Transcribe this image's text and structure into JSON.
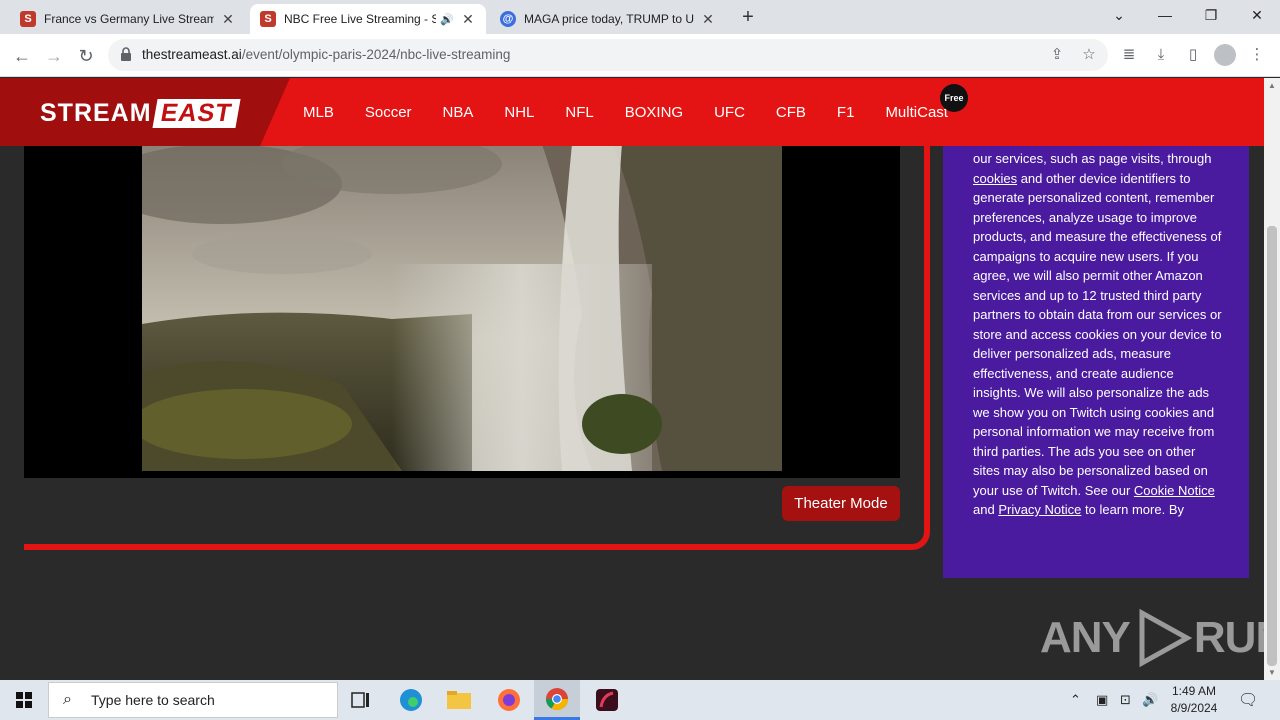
{
  "browser": {
    "tabs": [
      {
        "title": "France vs Germany Live Streamin",
        "favicon": "S",
        "favicon_color": "#c0392b",
        "active": false
      },
      {
        "title": "NBC Free Live Streaming - S",
        "favicon": "S",
        "favicon_color": "#c0392b",
        "active": true,
        "audio": "🔊"
      },
      {
        "title": "MAGA price today, TRUMP to US",
        "favicon": "@",
        "favicon_color": "#3b6fe0",
        "active": false
      }
    ],
    "url_host": "thestreameast.ai",
    "url_path": "/event/olympic-paris-2024/nbc-live-streaming"
  },
  "site": {
    "logo_left": "STREAM",
    "logo_right": "EAST",
    "nav": [
      "MLB",
      "Soccer",
      "NBA",
      "NHL",
      "NFL",
      "BOXING",
      "UFC",
      "CFB",
      "F1",
      "MultiCast"
    ],
    "free_badge": "Free",
    "brand_color": "#e51414"
  },
  "player": {
    "theater_label": "Theater Mode"
  },
  "consent": {
    "text_1": "our services, such as page visits, through ",
    "link_cookies": "cookies",
    "text_2": " and other device identifiers to generate personalized content, remember preferences, analyze usage to improve products, and measure the effectiveness of campaigns to acquire new users. If you agree, we will also permit other Amazon services and up to 12 trusted third party partners to obtain data from our services or store and access cookies on your device to deliver personalized ads, measure effectiveness, and create audience insights. We will also personalize the ads we show you on Twitch using cookies and personal information we may receive from third parties. The ads you see on other sites may also be personalized based on your use of Twitch. See our ",
    "link_cookie_notice": "Cookie Notice",
    "text_3": " and ",
    "link_privacy": "Privacy Notice",
    "text_4": " to learn more. By",
    "bg_color": "#4a1b9e"
  },
  "watermark": {
    "left": "ANY",
    "right": "RUN"
  },
  "taskbar": {
    "search_placeholder": "Type here to search",
    "time": "1:49 AM",
    "date": "8/9/2024"
  }
}
